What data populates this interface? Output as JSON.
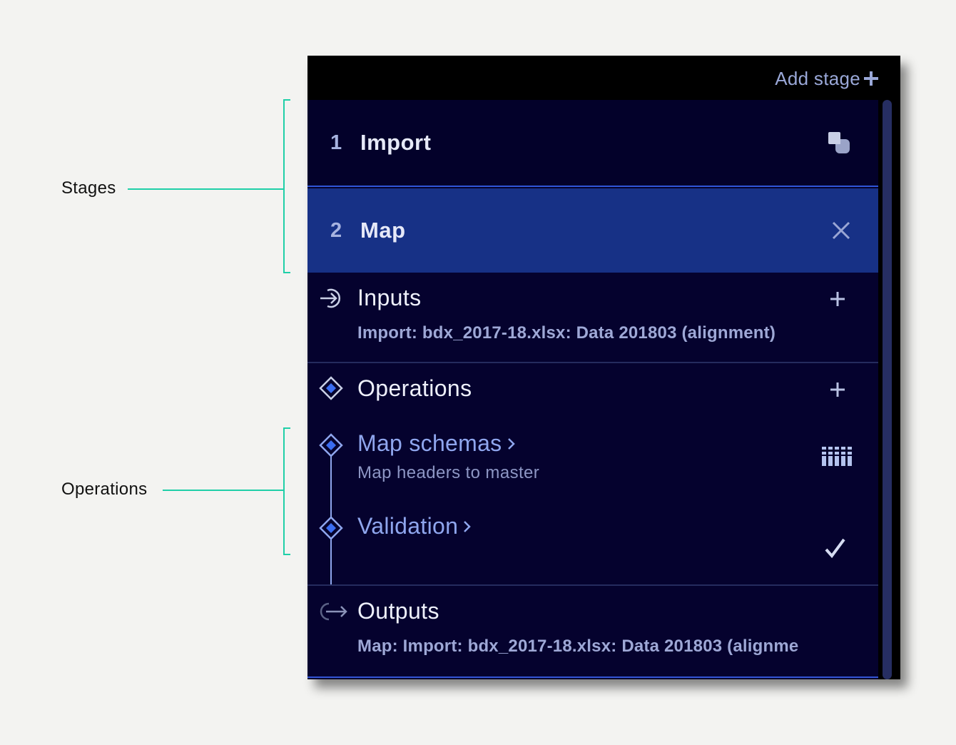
{
  "annotations": {
    "stages_label": "Stages",
    "operations_label": "Operations"
  },
  "toolbar": {
    "add_stage_label": "Add stage"
  },
  "stages": [
    {
      "number": "1",
      "name": "Import",
      "icon": "stage-blocks-icon",
      "selected": false
    },
    {
      "number": "2",
      "name": "Map",
      "icon": "close-icon",
      "selected": true
    }
  ],
  "inputs": {
    "title": "Inputs",
    "value": "Import: bdx_2017-18.xlsx: Data 201803 (alignment)"
  },
  "operations": {
    "title": "Operations",
    "items": [
      {
        "title": "Map schemas",
        "subtitle": "Map headers to master",
        "icon": "columns-icon"
      },
      {
        "title": "Validation",
        "subtitle": "",
        "icon": "check-icon"
      }
    ]
  },
  "outputs": {
    "title": "Outputs",
    "value": "Map: Import: bdx_2017-18.xlsx: Data 201803 (alignme"
  },
  "colors": {
    "panel_bg": "#05022e",
    "selected_stage": "#173186",
    "accent": "#3a6cf0",
    "annotation": "#1fcfa8"
  }
}
